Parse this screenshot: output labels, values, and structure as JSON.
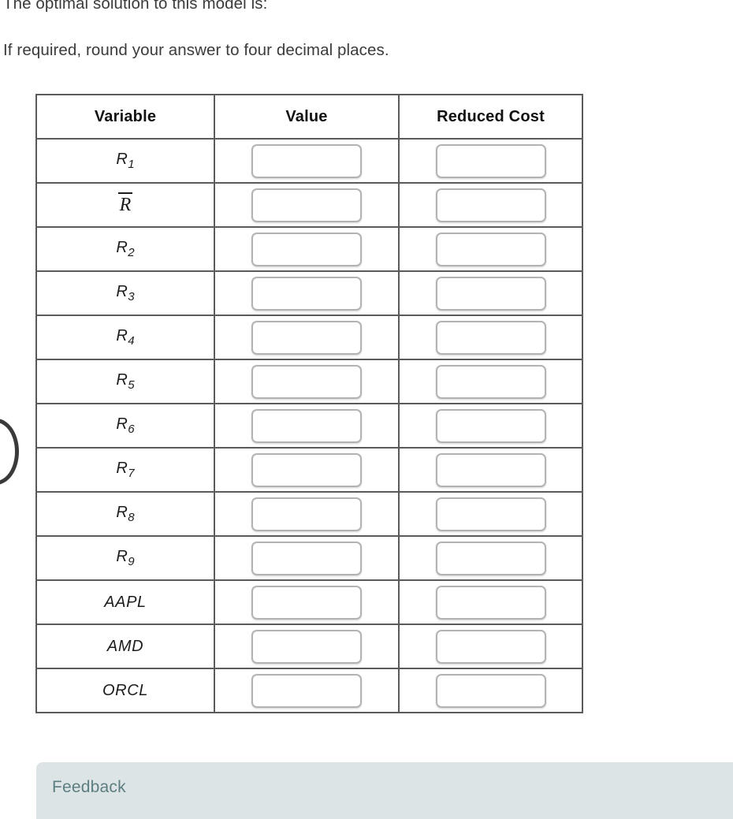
{
  "prompt": {
    "line1": "The optimal solution to this model is:",
    "line2": "If required, round your answer to four decimal places."
  },
  "table": {
    "headers": {
      "variable": "Variable",
      "value": "Value",
      "reduced_cost": "Reduced Cost"
    },
    "rows": [
      {
        "base": "R",
        "sub": "1",
        "style": "subscript",
        "value": "",
        "reduced_cost": ""
      },
      {
        "base": "R",
        "sub": "",
        "style": "overline",
        "value": "",
        "reduced_cost": ""
      },
      {
        "base": "R",
        "sub": "2",
        "style": "subscript",
        "value": "",
        "reduced_cost": ""
      },
      {
        "base": "R",
        "sub": "3",
        "style": "subscript",
        "value": "",
        "reduced_cost": ""
      },
      {
        "base": "R",
        "sub": "4",
        "style": "subscript",
        "value": "",
        "reduced_cost": ""
      },
      {
        "base": "R",
        "sub": "5",
        "style": "subscript",
        "value": "",
        "reduced_cost": ""
      },
      {
        "base": "R",
        "sub": "6",
        "style": "subscript",
        "value": "",
        "reduced_cost": ""
      },
      {
        "base": "R",
        "sub": "7",
        "style": "subscript",
        "value": "",
        "reduced_cost": ""
      },
      {
        "base": "R",
        "sub": "8",
        "style": "subscript",
        "value": "",
        "reduced_cost": ""
      },
      {
        "base": "R",
        "sub": "9",
        "style": "subscript",
        "value": "",
        "reduced_cost": ""
      },
      {
        "base": "AAPL",
        "sub": "",
        "style": "ticker",
        "value": "",
        "reduced_cost": ""
      },
      {
        "base": "AMD",
        "sub": "",
        "style": "ticker",
        "value": "",
        "reduced_cost": ""
      },
      {
        "base": "ORCL",
        "sub": "",
        "style": "ticker",
        "value": "",
        "reduced_cost": ""
      }
    ]
  },
  "feedback": {
    "title": "Feedback"
  },
  "colors": {
    "text": "#3b3b3b",
    "table_border": "#5a5a5a",
    "input_border": "#b3b3b3",
    "feedback_bg": "#dde4e6",
    "feedback_text": "#5c7e80"
  }
}
